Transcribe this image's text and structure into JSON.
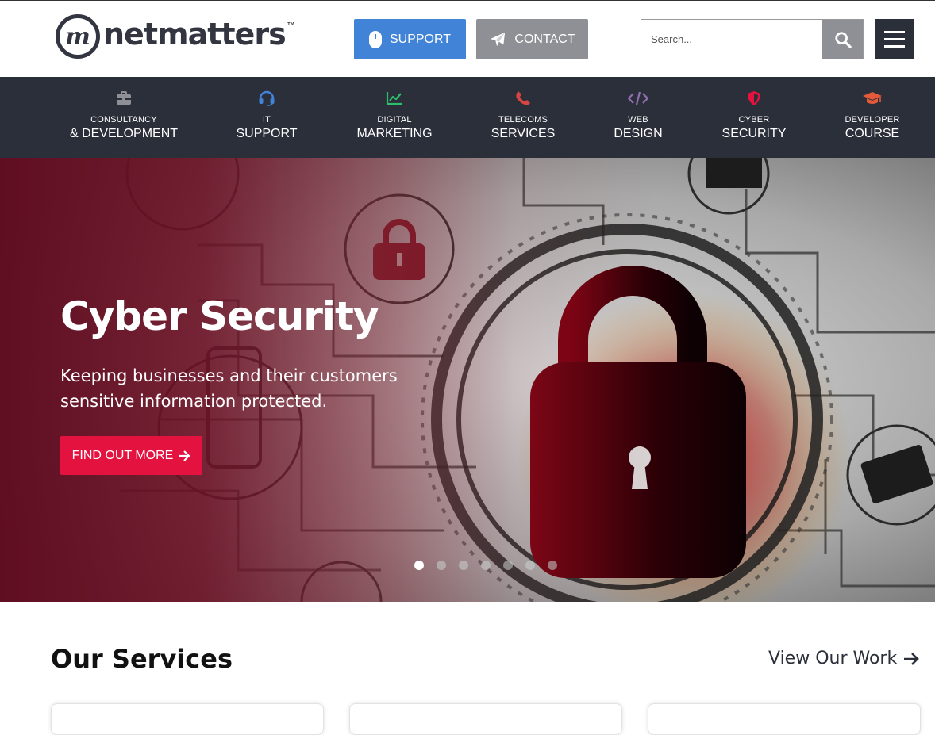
{
  "header": {
    "logo": {
      "mark": "m",
      "text": "netmatters",
      "tm": "™"
    },
    "support_label": "SUPPORT",
    "contact_label": "CONTACT",
    "search": {
      "placeholder": "Search...",
      "value": ""
    },
    "colors": {
      "support": "#4183d7",
      "contact": "#8f9096",
      "menu": "#2b2f3a"
    }
  },
  "nav": {
    "items": [
      {
        "small": "CONSULTANCY",
        "big": "& DEVELOPMENT",
        "icon": "briefcase-icon",
        "color": "#8f9096"
      },
      {
        "small": "IT",
        "big": "SUPPORT",
        "icon": "headset-icon",
        "color": "#4183d7"
      },
      {
        "small": "DIGITAL",
        "big": "MARKETING",
        "icon": "chart-line-icon",
        "color": "#2dbe6c"
      },
      {
        "small": "TELECOMS",
        "big": "SERVICES",
        "icon": "phone-icon",
        "color": "#d64541"
      },
      {
        "small": "WEB",
        "big": "DESIGN",
        "icon": "code-icon",
        "color": "#926fb1"
      },
      {
        "small": "CYBER",
        "big": "SECURITY",
        "icon": "shield-icon",
        "color": "#e4123f"
      },
      {
        "small": "DEVELOPER",
        "big": "COURSE",
        "icon": "graduation-cap-icon",
        "color": "#e25a3a"
      }
    ]
  },
  "hero": {
    "title": "Cyber Security",
    "subtitle": "Keeping businesses and their customers sensitive information protected.",
    "cta": "FIND OUT MORE",
    "cta_color": "#e4123f",
    "slide_count": 7,
    "active_slide": 1
  },
  "services": {
    "title": "Our Services",
    "view_work": "View Our Work"
  }
}
